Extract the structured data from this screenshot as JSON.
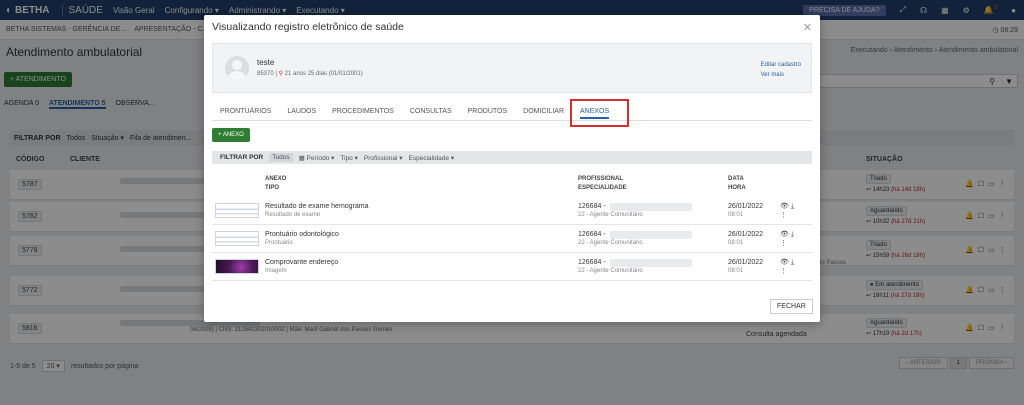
{
  "topbar": {
    "logo": "BETHA",
    "product": "SAÚDE",
    "menu": [
      "Visão Geral",
      "Configurando ▾",
      "Administrando ▾",
      "Executando ▾"
    ],
    "help": "PRECISA DE AJUDA?",
    "notif_count": "3"
  },
  "subbar": {
    "org": "BETHA SISTEMAS - GERÊNCIA DE...",
    "unit": "APRESENTAÇÃO - C...",
    "clock": "08:29"
  },
  "page": {
    "title": "Atendimento ambulatorial",
    "breadcrumb": "Executando › Atendimento › Atendimento ambulatorial",
    "new_button": "+ ATENDIMENTO",
    "tabs": [
      "AGENDA 0",
      "ATENDIMENTO 5",
      "OBSERVA..."
    ],
    "filter_label": "FILTRAR POR",
    "filter_items": [
      "Todos",
      "Situação ▾",
      "Fila de atendimen..."
    ],
    "col_codigo": "CÓDIGO",
    "col_cliente": "CLIENTE",
    "col_situacao": "SITUAÇÃO",
    "rows": [
      {
        "code": "5787",
        "status": "Triado",
        "time": "14h23",
        "elapsed": "(há 14d 18h)"
      },
      {
        "code": "5762",
        "status": "Aguardando",
        "time": "10h32",
        "elapsed": "(há 27d 21h)"
      },
      {
        "code": "5778",
        "status": "Triado",
        "time": "15h59",
        "elapsed": "(há 26d 18h)"
      },
      {
        "code": "5772",
        "status": "Em atendimento",
        "time": "16h11",
        "elapsed": "(há 27d 18h)"
      },
      {
        "code": "5816",
        "status": "Aguardando",
        "time": "17h19",
        "elapsed": "(há 2d 17h)"
      }
    ],
    "bg_patient_text": "08/2008) | CNS: 212642302010002 | Mãe: Marli Gabriel dos Passos Gomes",
    "consulta_agendada": "Consulta agendada",
    "passos_fragment": "lo Passos",
    "result_count": "1-5 de 5",
    "page_size": "20 ▾",
    "per_page_label": "resultados por página",
    "prev": "‹ ANTERIOR",
    "page_num": "1",
    "next": "PRÓXIMA ›"
  },
  "modal": {
    "title": "Visualizando registro eletrônico de saúde",
    "patient_name": "teste",
    "patient_id": "85370",
    "patient_age": "21 anos 25 dias (01/01/2001)",
    "edit_link": "Editar cadastro",
    "more_link": "Ver mais",
    "tabs": [
      "PRONTUÁRIOS",
      "LAUDOS",
      "PROCEDIMENTOS",
      "CONSULTAS",
      "PRODUTOS",
      "DOMICILIAR",
      "ANEXOS"
    ],
    "anexo_button": "+ ANEXO",
    "filter_label": "FILTRAR POR",
    "filter_items": [
      "Todos",
      "Período ▾",
      "Tipo ▾",
      "Profissional ▾",
      "Especialidade ▾"
    ],
    "col_anexo": "ANEXO",
    "col_tipo": "TIPO",
    "col_profissional": "PROFISSIONAL",
    "col_especialidade": "ESPECIALIDADE",
    "col_data": "DATA",
    "col_hora": "HORA",
    "rows": [
      {
        "name": "Resultado de exame hemograma",
        "type": "Resultado de exame",
        "prof": "126684 -",
        "spec": "22 - Agente Comunitário",
        "date": "26/01/2022",
        "hour": "08:01"
      },
      {
        "name": "Prontuário odontológico",
        "type": "Prontuário",
        "prof": "126684 -",
        "spec": "22 - Agente Comunitário",
        "date": "26/01/2022",
        "hour": "08:01"
      },
      {
        "name": "Comprovante endereço",
        "type": "Imagem",
        "prof": "126684 -",
        "spec": "22 - Agente Comunitário",
        "date": "26/01/2022",
        "hour": "08:01"
      }
    ],
    "close_button": "FECHAR"
  }
}
